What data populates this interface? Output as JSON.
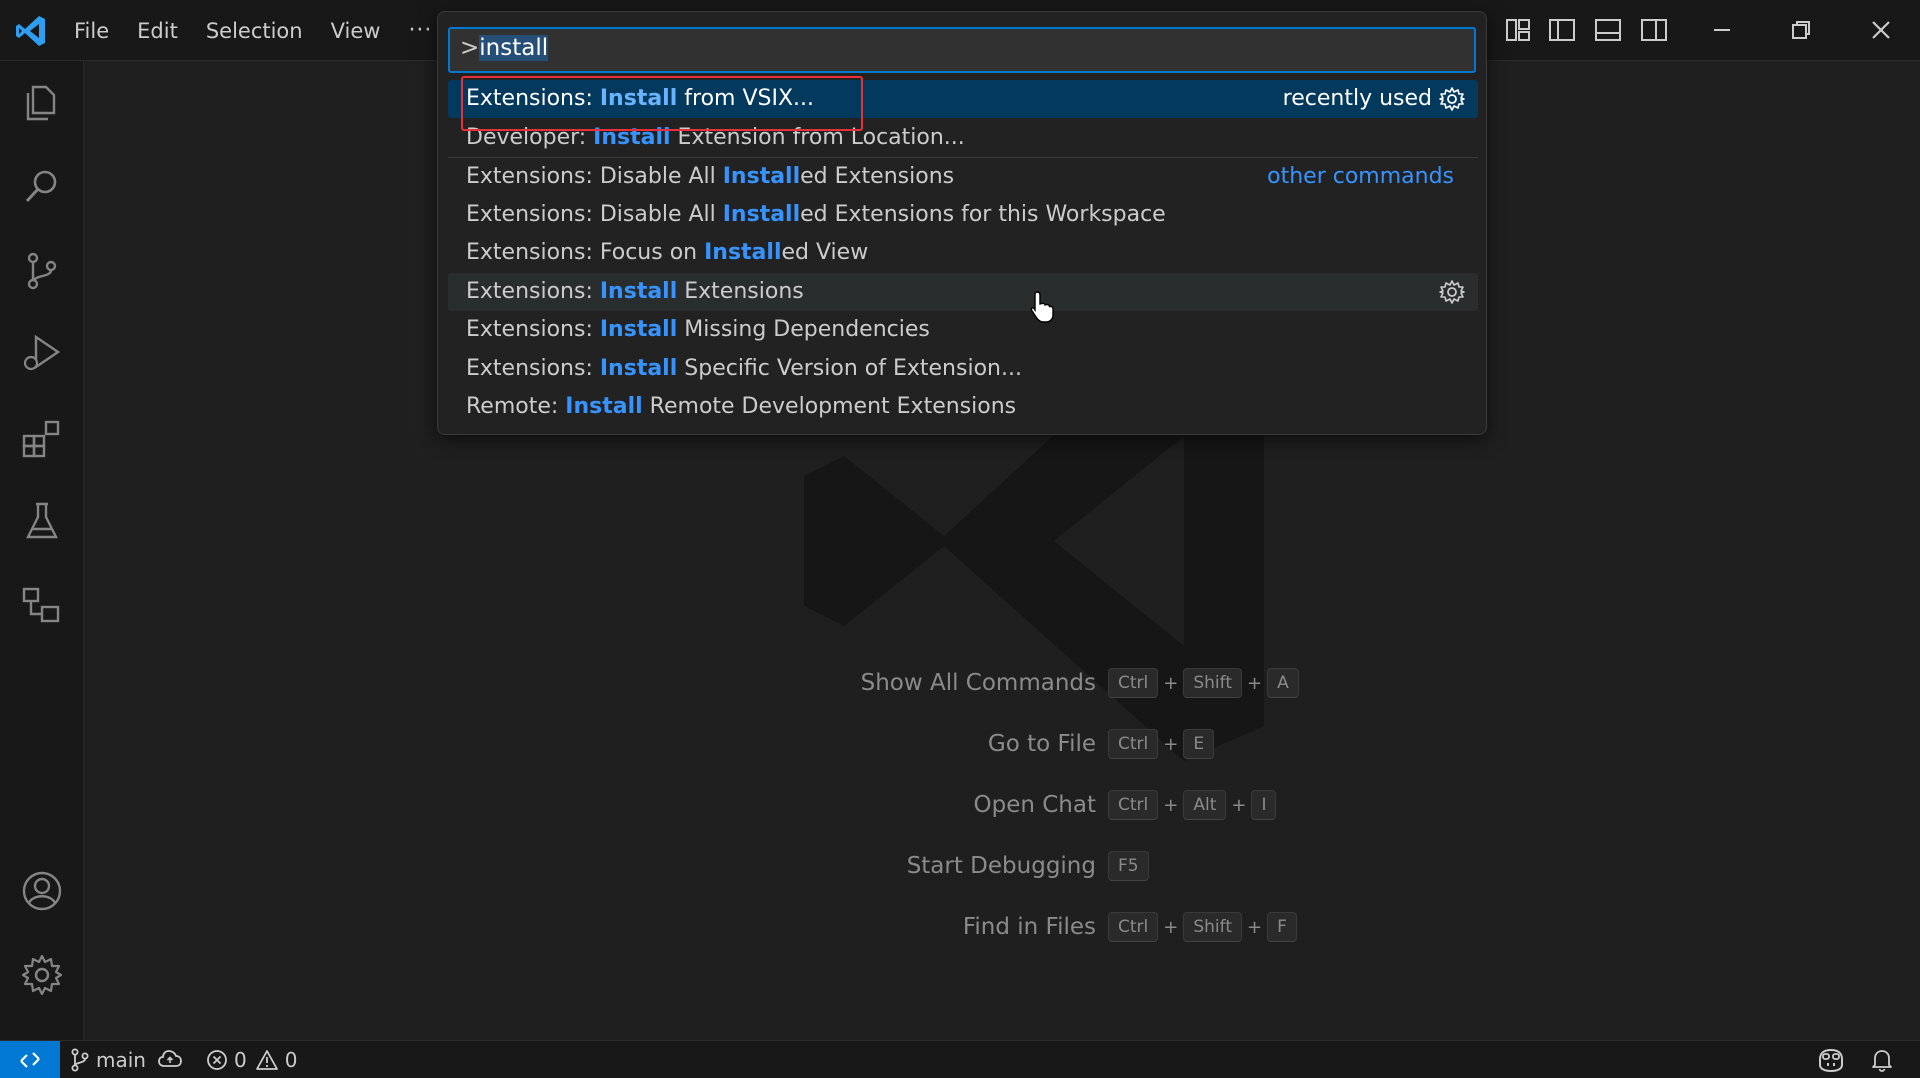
{
  "titlebar": {
    "menu": [
      "File",
      "Edit",
      "Selection",
      "View"
    ],
    "more": "···"
  },
  "palette": {
    "prefix": ">",
    "query": "install",
    "items": [
      {
        "prefix": "Extensions: ",
        "match": "Install",
        "suffix": " from VSIX...",
        "right": "recently used",
        "gear": true,
        "active": true
      },
      {
        "prefix": "Developer: ",
        "match": "Install",
        "suffix": " Extension from Location...",
        "right": "",
        "gear": false
      },
      {
        "prefix": "Extensions: Disable All ",
        "match": "Install",
        "suffix": "ed Extensions",
        "right_link": "other commands",
        "gear": false
      },
      {
        "prefix": "Extensions: Disable All ",
        "match": "Install",
        "suffix": "ed Extensions for this Workspace",
        "gear": false
      },
      {
        "prefix": "Extensions: Focus on ",
        "match": "Install",
        "suffix": "ed View",
        "gear": false
      },
      {
        "prefix": "Extensions: ",
        "match": "Install",
        "suffix": " Extensions",
        "gear": true,
        "hover": true
      },
      {
        "prefix": "Extensions: ",
        "match": "Install",
        "suffix": " Missing Dependencies",
        "gear": false
      },
      {
        "prefix": "Extensions: ",
        "match": "Install",
        "suffix": " Specific Version of Extension...",
        "gear": false
      },
      {
        "prefix": "Remote: ",
        "match": "Install",
        "suffix": " Remote Development Extensions",
        "gear": false
      }
    ]
  },
  "welcome": {
    "shortcuts": [
      {
        "label": "Show All Commands",
        "keys": [
          "Ctrl",
          "Shift",
          "A"
        ]
      },
      {
        "label": "Go to File",
        "keys": [
          "Ctrl",
          "E"
        ]
      },
      {
        "label": "Open Chat",
        "keys": [
          "Ctrl",
          "Alt",
          "I"
        ]
      },
      {
        "label": "Start Debugging",
        "keys": [
          "F5"
        ]
      },
      {
        "label": "Find in Files",
        "keys": [
          "Ctrl",
          "Shift",
          "F"
        ]
      }
    ],
    "plus": "+"
  },
  "statusbar": {
    "branch": "main",
    "errors": "0",
    "warnings": "0"
  },
  "colors": {
    "accent": "#0078d4",
    "highlight": "#3794ff",
    "annotation": "#e8303a"
  }
}
